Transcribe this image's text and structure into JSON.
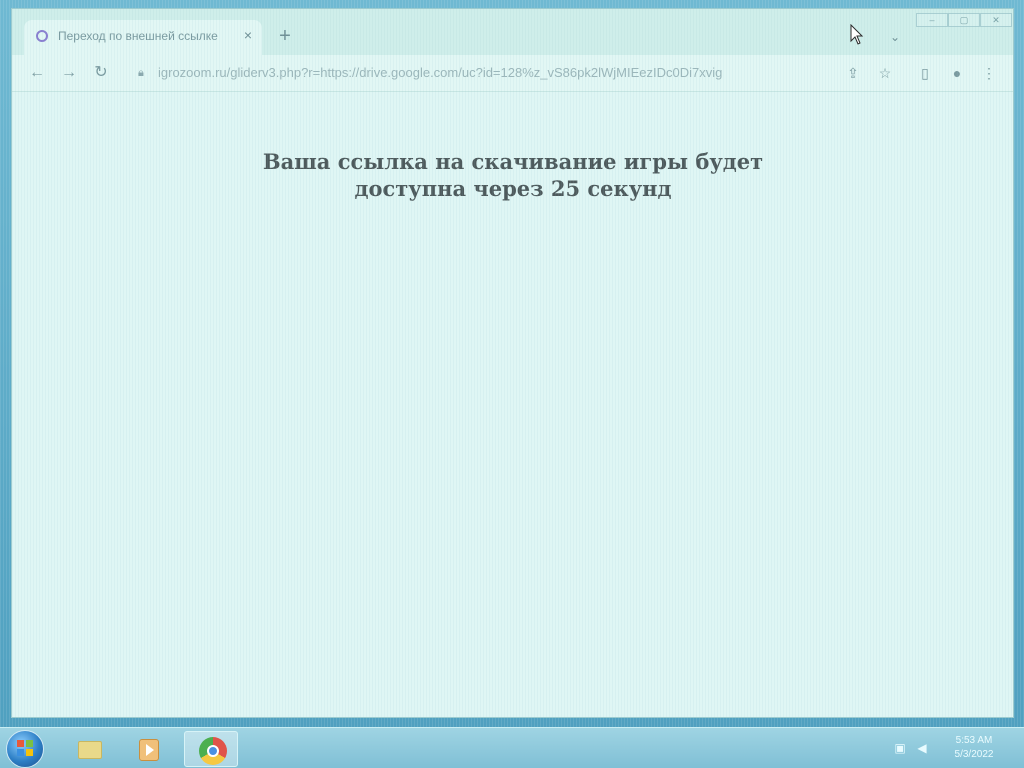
{
  "browser": {
    "tab": {
      "title": "Переход по внешней ссылке",
      "close_glyph": "×"
    },
    "new_tab_glyph": "+",
    "tab_search_glyph": "⌄",
    "window_controls": [
      "–",
      "▢",
      "✕"
    ],
    "address_bar": {
      "url": "igrozoom.ru/gliderv3.php?r=https://drive.google.com/uc?id=128%z_vS86pk2lWjMIEezIDc0Di7xvig"
    },
    "icons": {
      "back": "back-icon",
      "forward": "forward-icon",
      "reload": "reload-icon",
      "lock": "lock-icon",
      "share": "share-icon",
      "bookmark": "star-icon",
      "sidepanel": "side-panel-icon",
      "profile": "profile-icon",
      "menu": "menu-icon"
    }
  },
  "page": {
    "message_line1": "Ваша ссылка на скачивание игры будет",
    "message_line2": "доступна через 25 секунд"
  },
  "taskbar": {
    "apps": [
      "file-explorer",
      "media-player",
      "chrome"
    ],
    "clock": {
      "time": "5:53 AM",
      "date": "5/3/2022"
    }
  }
}
